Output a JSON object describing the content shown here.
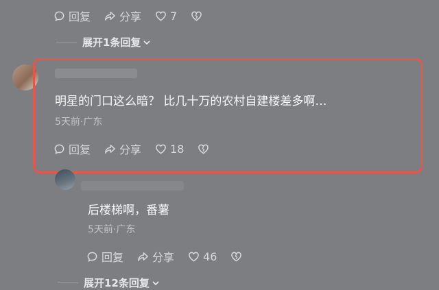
{
  "top_actions": {
    "reply": "回复",
    "share": "分享",
    "likes": "7"
  },
  "expand_top": {
    "label": "展开1条回复"
  },
  "main_comment": {
    "text": "明星的门口这么暗？ 比几十万的农村自建楼差多啊…",
    "meta": "5天前·广东",
    "reply": "回复",
    "share": "分享",
    "likes": "18"
  },
  "sub_comment": {
    "text": "后楼梯啊，番薯",
    "meta": "5天前·广东",
    "reply": "回复",
    "share": "分享",
    "likes": "46"
  },
  "expand_bottom": {
    "label": "展开12条回复"
  },
  "colors": {
    "background": "#7d7e82",
    "highlight": "#e8554a",
    "text": "#f7f7f7"
  }
}
